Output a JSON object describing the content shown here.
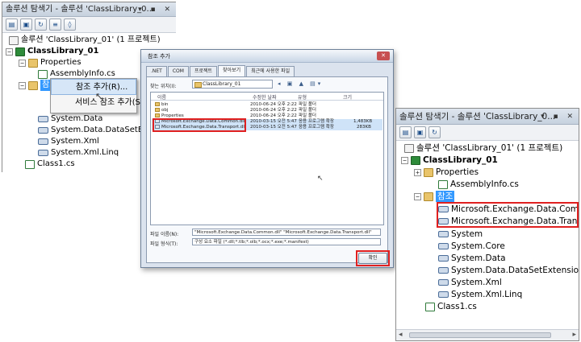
{
  "left_panel": {
    "title": "솔루션 탐색기 - 솔루션 'ClassLibrary_0...",
    "title_controls": "▾ ▪ ✕",
    "solution_label": "솔루션 'ClassLibrary_01' (1 프로젝트)",
    "project_label": "ClassLibrary_01",
    "properties_label": "Properties",
    "assemblyinfo_label": "AssemblyInfo.cs",
    "references_label": "참조",
    "ref_items": [
      "System.Data",
      "System.Data.DataSetExtensions",
      "System.Xml",
      "System.Xml.Linq"
    ],
    "class_label": "Class1.cs"
  },
  "context_menu": {
    "items": [
      "참조 추가(R)...",
      "서비스 참조 추가(S)..."
    ]
  },
  "dialog": {
    "title": "참조 추가",
    "close_label": "✕",
    "tabs": [
      ".NET",
      "COM",
      "프로젝트",
      "찾아보기",
      "최근에 사용한 파일"
    ],
    "look_in_label": "찾는 위치(I):",
    "look_in_value": "ClassLibrary_01",
    "nav_icons": "◂ ▣ ▲ ▤▾",
    "columns": [
      "이름",
      "수정한 날짜",
      "유형",
      "크기"
    ],
    "files": [
      {
        "name": "bin",
        "date": "2010-06-24 오후 2:22",
        "type": "파일 폴더",
        "size": ""
      },
      {
        "name": "obj",
        "date": "2010-06-24 오후 2:22",
        "type": "파일 폴더",
        "size": ""
      },
      {
        "name": "Properties",
        "date": "2010-06-24 오후 2:22",
        "type": "파일 폴더",
        "size": ""
      },
      {
        "name": "Microsoft.Exchange.Data.Common.dll",
        "date": "2010-03-15 오전 5:47",
        "type": "응용 프로그램 확장",
        "size": "1,483KB"
      },
      {
        "name": "Microsoft.Exchange.Data.Transport.dll",
        "date": "2010-03-15 오전 5:47",
        "type": "응용 프로그램 확장",
        "size": "283KB"
      }
    ],
    "filename_label": "파일 이름(N):",
    "filename_value": "\"Microsoft.Exchange.Data.Common.dll\" \"Microsoft.Exchange.Data.Transport.dll\"",
    "filetype_label": "파일 형식(T):",
    "filetype_value": "구성 요소 파일 (*.dll;*.tlb;*.olb;*.ocx;*.exe;*.manifest)",
    "ok_label": "확인"
  },
  "right_panel": {
    "title": "솔루션 탐색기 - 솔루션 'ClassLibrary_0...",
    "title_controls": "▾ ▪ ✕",
    "solution_label": "솔루션 'ClassLibrary_01' (1 프로젝트)",
    "project_label": "ClassLibrary_01",
    "properties_label": "Properties",
    "assemblyinfo_label": "AssemblyInfo.cs",
    "references_label": "참조",
    "new_refs": [
      "Microsoft.Exchange.Data.Common",
      "Microsoft.Exchange.Data.Transport"
    ],
    "ref_items": [
      "System",
      "System.Core",
      "System.Data",
      "System.Data.DataSetExtensions",
      "System.Xml",
      "System.Xml.Linq"
    ],
    "class_label": "Class1.cs"
  }
}
